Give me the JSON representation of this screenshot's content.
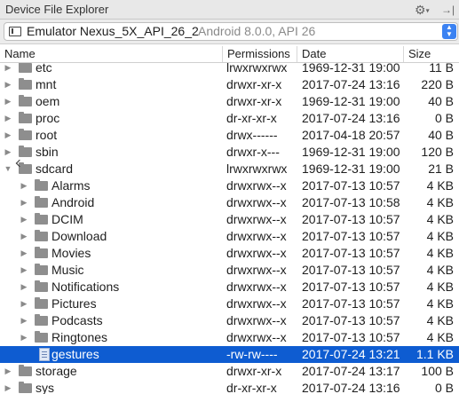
{
  "window": {
    "title": "Device File Explorer"
  },
  "device": {
    "name": "Emulator Nexus_5X_API_26_2",
    "details": "Android 8.0.0, API 26"
  },
  "columns": {
    "name": "Name",
    "permissions": "Permissions",
    "date": "Date",
    "size": "Size"
  },
  "rows": [
    {
      "name": "etc",
      "permissions": "lrwxrwxrwx",
      "date": "1969-12-31 19:00",
      "size": "11 B",
      "type": "folder",
      "depth": 0,
      "expanded": false,
      "selected": false
    },
    {
      "name": "mnt",
      "permissions": "drwxr-xr-x",
      "date": "2017-07-24 13:16",
      "size": "220 B",
      "type": "folder",
      "depth": 0,
      "expanded": false,
      "selected": false
    },
    {
      "name": "oem",
      "permissions": "drwxr-xr-x",
      "date": "1969-12-31 19:00",
      "size": "40 B",
      "type": "folder",
      "depth": 0,
      "expanded": false,
      "selected": false
    },
    {
      "name": "proc",
      "permissions": "dr-xr-xr-x",
      "date": "2017-07-24 13:16",
      "size": "0 B",
      "type": "folder",
      "depth": 0,
      "expanded": false,
      "selected": false
    },
    {
      "name": "root",
      "permissions": "drwx------",
      "date": "2017-04-18 20:57",
      "size": "40 B",
      "type": "folder",
      "depth": 0,
      "expanded": false,
      "selected": false
    },
    {
      "name": "sbin",
      "permissions": "drwxr-x---",
      "date": "1969-12-31 19:00",
      "size": "120 B",
      "type": "folder",
      "depth": 0,
      "expanded": false,
      "selected": false
    },
    {
      "name": "sdcard",
      "permissions": "lrwxrwxrwx",
      "date": "1969-12-31 19:00",
      "size": "21 B",
      "type": "link",
      "depth": 0,
      "expanded": true,
      "selected": false
    },
    {
      "name": "Alarms",
      "permissions": "drwxrwx--x",
      "date": "2017-07-13 10:57",
      "size": "4 KB",
      "type": "folder",
      "depth": 1,
      "expanded": false,
      "selected": false
    },
    {
      "name": "Android",
      "permissions": "drwxrwx--x",
      "date": "2017-07-13 10:58",
      "size": "4 KB",
      "type": "folder",
      "depth": 1,
      "expanded": false,
      "selected": false
    },
    {
      "name": "DCIM",
      "permissions": "drwxrwx--x",
      "date": "2017-07-13 10:57",
      "size": "4 KB",
      "type": "folder",
      "depth": 1,
      "expanded": false,
      "selected": false
    },
    {
      "name": "Download",
      "permissions": "drwxrwx--x",
      "date": "2017-07-13 10:57",
      "size": "4 KB",
      "type": "folder",
      "depth": 1,
      "expanded": false,
      "selected": false
    },
    {
      "name": "Movies",
      "permissions": "drwxrwx--x",
      "date": "2017-07-13 10:57",
      "size": "4 KB",
      "type": "folder",
      "depth": 1,
      "expanded": false,
      "selected": false
    },
    {
      "name": "Music",
      "permissions": "drwxrwx--x",
      "date": "2017-07-13 10:57",
      "size": "4 KB",
      "type": "folder",
      "depth": 1,
      "expanded": false,
      "selected": false
    },
    {
      "name": "Notifications",
      "permissions": "drwxrwx--x",
      "date": "2017-07-13 10:57",
      "size": "4 KB",
      "type": "folder",
      "depth": 1,
      "expanded": false,
      "selected": false
    },
    {
      "name": "Pictures",
      "permissions": "drwxrwx--x",
      "date": "2017-07-13 10:57",
      "size": "4 KB",
      "type": "folder",
      "depth": 1,
      "expanded": false,
      "selected": false
    },
    {
      "name": "Podcasts",
      "permissions": "drwxrwx--x",
      "date": "2017-07-13 10:57",
      "size": "4 KB",
      "type": "folder",
      "depth": 1,
      "expanded": false,
      "selected": false
    },
    {
      "name": "Ringtones",
      "permissions": "drwxrwx--x",
      "date": "2017-07-13 10:57",
      "size": "4 KB",
      "type": "folder",
      "depth": 1,
      "expanded": false,
      "selected": false
    },
    {
      "name": "gestures",
      "permissions": "-rw-rw----",
      "date": "2017-07-24 13:21",
      "size": "1.1 KB",
      "type": "file",
      "depth": 1,
      "expanded": false,
      "selected": true
    },
    {
      "name": "storage",
      "permissions": "drwxr-xr-x",
      "date": "2017-07-24 13:17",
      "size": "100 B",
      "type": "folder",
      "depth": 0,
      "expanded": false,
      "selected": false
    },
    {
      "name": "sys",
      "permissions": "dr-xr-xr-x",
      "date": "2017-07-24 13:16",
      "size": "0 B",
      "type": "folder",
      "depth": 0,
      "expanded": false,
      "selected": false
    }
  ],
  "icons": {
    "settings": "gear-icon",
    "hide": "hide-panel-icon",
    "device": "phone-device-icon",
    "dropdown": "dropdown-arrows-icon"
  },
  "colors": {
    "selection": "#0e5cd1",
    "accent": "#3b82f2",
    "folder": "#8e8e8e"
  }
}
